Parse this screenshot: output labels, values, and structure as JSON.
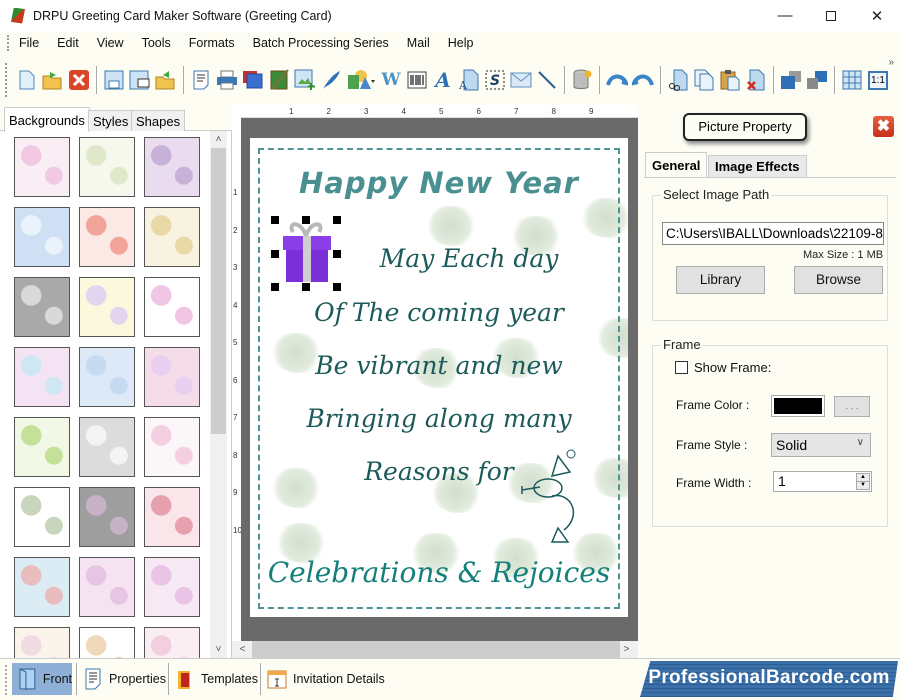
{
  "window": {
    "title": "DRPU Greeting Card Maker Software (Greeting Card)",
    "minimize_icon": "minimize-icon",
    "maximize_icon": "maximize-icon",
    "close_icon": "close-icon"
  },
  "menubar": {
    "items": [
      "File",
      "Edit",
      "View",
      "Tools",
      "Formats",
      "Batch Processing Series",
      "Mail",
      "Help"
    ]
  },
  "toolbar": {
    "buttons": [
      {
        "name": "new-icon"
      },
      {
        "name": "open-icon"
      },
      {
        "name": "close-file-icon"
      },
      {
        "name": "save-icon"
      },
      {
        "name": "save-as-icon"
      },
      {
        "name": "export-icon"
      },
      {
        "name": "page-properties-icon"
      },
      {
        "name": "print-icon"
      },
      {
        "name": "background-icon"
      },
      {
        "name": "image-edit-icon"
      },
      {
        "name": "insert-image-icon"
      },
      {
        "name": "signature-icon"
      },
      {
        "name": "shapes-icon"
      },
      {
        "name": "wordart-icon"
      },
      {
        "name": "barcode-icon"
      },
      {
        "name": "text-icon"
      },
      {
        "name": "text-file-icon"
      },
      {
        "name": "symbol-icon"
      },
      {
        "name": "email-icon"
      },
      {
        "name": "line-icon"
      },
      {
        "name": "database-icon"
      },
      {
        "name": "undo-icon"
      },
      {
        "name": "redo-icon"
      },
      {
        "name": "cut-icon"
      },
      {
        "name": "copy-icon"
      },
      {
        "name": "paste-icon"
      },
      {
        "name": "delete-icon"
      },
      {
        "name": "bring-forward-icon"
      },
      {
        "name": "send-backward-icon"
      },
      {
        "name": "grid-icon"
      },
      {
        "name": "actual-size-icon"
      }
    ],
    "actual_size_label": "1:1",
    "overflow": "»"
  },
  "left_panel": {
    "tabs": [
      "Backgrounds",
      "Styles",
      "Shapes"
    ],
    "active_tab": "Backgrounds",
    "thumbnails": [
      {
        "name": "baby-pink-pattern",
        "colors": [
          "#f8eef4",
          "#f1c9e3"
        ]
      },
      {
        "name": "baby-items-pattern",
        "colors": [
          "#f6f8ee",
          "#dfe9c9"
        ]
      },
      {
        "name": "purple-flowers",
        "colors": [
          "#e9dcef",
          "#c7b1d9"
        ]
      },
      {
        "name": "blue-clouds",
        "colors": [
          "#cfe0f5",
          "#eaf2fb"
        ]
      },
      {
        "name": "strawberries",
        "colors": [
          "#fbe9e6",
          "#f3a49a"
        ]
      },
      {
        "name": "pastel-fruits",
        "colors": [
          "#f8f2e0",
          "#e8d9a6"
        ]
      },
      {
        "name": "grey-leaves",
        "colors": [
          "#a9a9a9",
          "#d9d9d9"
        ]
      },
      {
        "name": "flower-rows",
        "colors": [
          "#fbf9dd",
          "#e3d4ef"
        ]
      },
      {
        "name": "gift-boxes",
        "colors": [
          "#ffffff",
          "#f1c5e4"
        ]
      },
      {
        "name": "pastel-blossoms",
        "colors": [
          "#f4e4f3",
          "#cfe6f3"
        ]
      },
      {
        "name": "blue-snowflakes",
        "colors": [
          "#dde9f7",
          "#c6dbf2"
        ]
      },
      {
        "name": "pastel-circles",
        "colors": [
          "#f4dde8",
          "#e8cfef"
        ]
      },
      {
        "name": "green-trees",
        "colors": [
          "#f1f8e6",
          "#c4e19a"
        ]
      },
      {
        "name": "white-heart",
        "colors": [
          "#dcdcdc",
          "#f4f4f4"
        ]
      },
      {
        "name": "birthday-doodles",
        "colors": [
          "#fbf6f8",
          "#f3cfe1"
        ]
      },
      {
        "name": "green-hearts",
        "colors": [
          "#ffffff",
          "#c7d6bd"
        ]
      },
      {
        "name": "fireworks",
        "colors": [
          "#9e9e9e",
          "#c7b3c7"
        ]
      },
      {
        "name": "red-hearts",
        "colors": [
          "#fae6ea",
          "#e7a0ad"
        ]
      },
      {
        "name": "santa-pattern",
        "colors": [
          "#dcecf4",
          "#e9bdbd"
        ]
      },
      {
        "name": "pink-dandelions",
        "colors": [
          "#f6e3f1",
          "#e7c3e4"
        ]
      },
      {
        "name": "pink-flowers",
        "colors": [
          "#f7e9f3",
          "#e9c4e6"
        ]
      },
      {
        "name": "pastel-stripes",
        "colors": [
          "#fbf4ea",
          "#f0dbe3"
        ]
      },
      {
        "name": "teddy-bear",
        "colors": [
          "#ffffff",
          "#f0d9bb"
        ]
      },
      {
        "name": "pink-pattern",
        "colors": [
          "#faeef3",
          "#f2cfdf"
        ]
      }
    ]
  },
  "rulers": {
    "top": [
      "1",
      "2",
      "3",
      "4",
      "5",
      "6",
      "7",
      "8",
      "9"
    ],
    "left": [
      "1",
      "2",
      "3",
      "4",
      "5",
      "6",
      "7",
      "8",
      "9",
      "10"
    ]
  },
  "card": {
    "title": "Happy New Year",
    "lines": [
      "May Each day",
      "Of The coming year",
      "Be vibrant and new",
      "Bringing along many",
      "Reasons for"
    ],
    "bottom": "Celebrations & Rejoices",
    "selected_image": "gift-box",
    "accent_color": "#4a9090",
    "text_color": "#1d5a5a"
  },
  "right_panel": {
    "header": "Picture Property",
    "tabs": [
      "General",
      "Image Effects"
    ],
    "active_tab": "General",
    "image_path_group": "Select Image Path",
    "image_path_value": "C:\\Users\\IBALL\\Downloads\\22109-8",
    "max_size": "Max Size : 1 MB",
    "library_button": "Library",
    "browse_button": "Browse",
    "frame_group": "Frame",
    "show_frame_label": "Show Frame:",
    "show_frame_checked": false,
    "frame_color_label": "Frame Color :",
    "frame_color_value": "#000000",
    "frame_color_button": ". . .",
    "frame_style_label": "Frame Style :",
    "frame_style_value": "Solid",
    "frame_width_label": "Frame Width :",
    "frame_width_value": "1"
  },
  "bottom_bar": {
    "buttons": [
      {
        "label": "Front",
        "icon": "front-page-icon",
        "active": true
      },
      {
        "label": "Properties",
        "icon": "properties-icon",
        "active": false
      },
      {
        "label": "Templates",
        "icon": "templates-icon",
        "active": false
      },
      {
        "label": "Invitation Details",
        "icon": "invitation-details-icon",
        "active": false
      }
    ],
    "brand": "ProfessionalBarcode.com"
  }
}
